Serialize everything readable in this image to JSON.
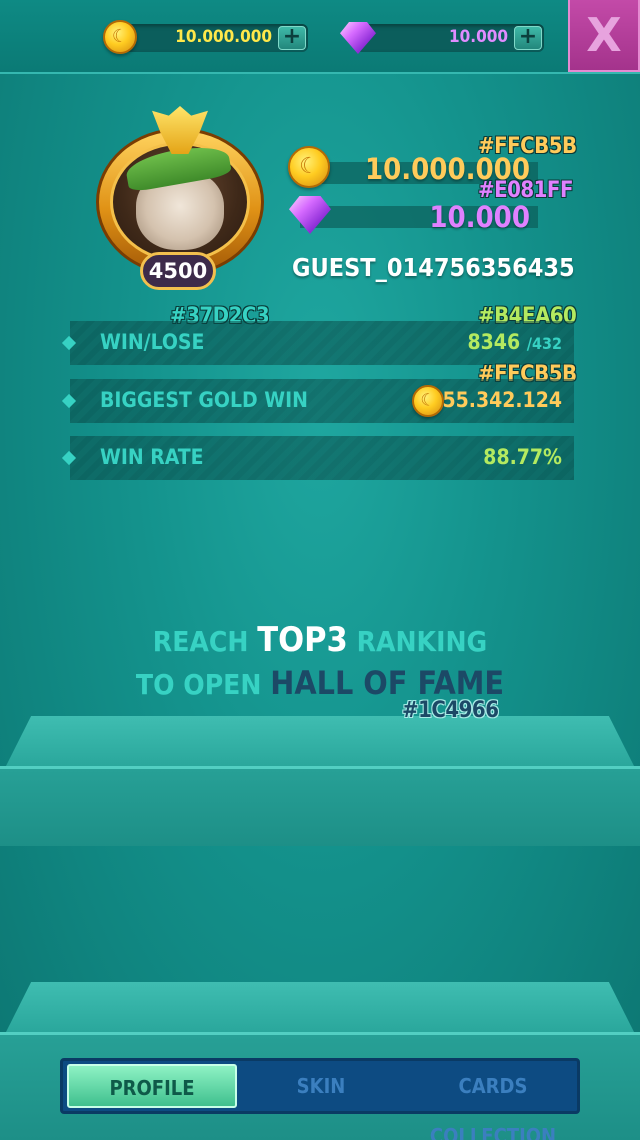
{
  "topbar": {
    "gold_amount": "10.000.000",
    "gem_amount": "10.000",
    "add_symbol": "+",
    "close_label": "X"
  },
  "profile": {
    "level": "4500",
    "gold_color_tag": "#FFCB5B",
    "gold_amount": "10.000.000",
    "gem_color_tag": "#E081FF",
    "gem_amount": "10.000",
    "username": "GUEST_014756356435"
  },
  "stats": {
    "label_color_tag": "#37D2C3",
    "win_color_tag": "#B4EA60",
    "rows": [
      {
        "label": "WIN/LOSE",
        "win": "8346",
        "lose": "/432"
      },
      {
        "label": "BIGGEST GOLD WIN",
        "value": "55.342.124",
        "value_color_tag": "#FFCB5B"
      },
      {
        "label": "WIN RATE",
        "value": "88.77%"
      }
    ]
  },
  "hall_of_fame": {
    "line1_pre": "REACH ",
    "line1_strong": "TOP3",
    "line1_post": " RANKING",
    "line2_pre": "TO OPEN ",
    "line2_dark": "HALL OF FAME",
    "dark_color_tag": "#1C4966"
  },
  "tabs": [
    {
      "label": "PROFILE",
      "active": true
    },
    {
      "label": "SKIN",
      "active": false
    },
    {
      "label": "CARDS COLLECTION",
      "active": false
    }
  ],
  "colors": {
    "gold": "#FFCB5B",
    "gem": "#E081FF",
    "label": "#37D2C3",
    "win": "#B4EA60",
    "hof_dark": "#1C4966"
  },
  "icons": [
    "gold-coin-icon",
    "purple-gem-icon",
    "plus-icon",
    "close-icon",
    "bulldog-avatar",
    "diamond-bullet-icon"
  ]
}
